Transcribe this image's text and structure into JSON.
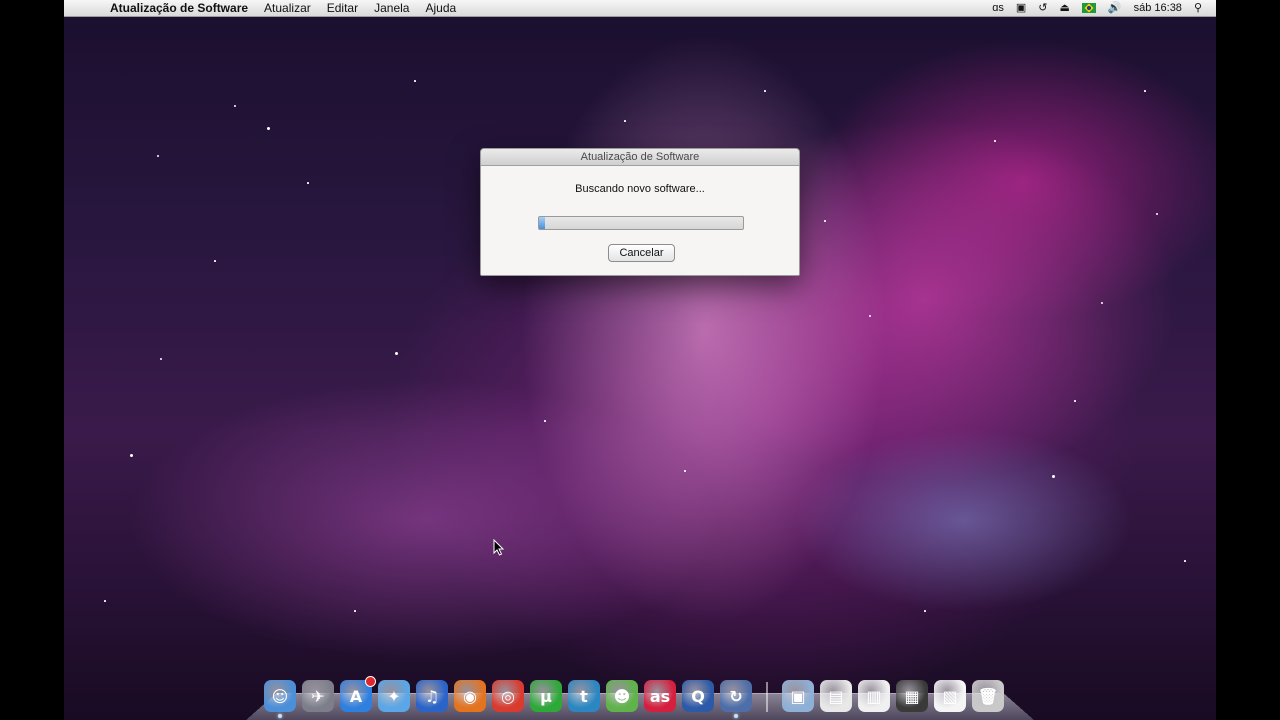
{
  "menubar": {
    "app_name": "Atualização de Software",
    "menus": [
      "Atualizar",
      "Editar",
      "Janela",
      "Ajuda"
    ],
    "clock": "sáb 16:38",
    "status_icons": [
      "lastfm-icon",
      "display-icon",
      "time-machine-icon",
      "eject-icon",
      "flag-brazil-icon",
      "volume-icon",
      "spotlight-icon"
    ]
  },
  "dialog": {
    "title": "Atualização de Software",
    "message": "Buscando novo software...",
    "progress_percent": 3,
    "cancel_label": "Cancelar"
  },
  "dock": {
    "apps": [
      {
        "name": "finder-icon",
        "glyph": "☺",
        "color": "#4a8fd8",
        "running": true
      },
      {
        "name": "launchpad-icon",
        "glyph": "✈",
        "color": "#7c7f8a",
        "running": false
      },
      {
        "name": "app-store-icon",
        "glyph": "A",
        "color": "#2f7fe0",
        "running": false,
        "badge": true
      },
      {
        "name": "safari-icon",
        "glyph": "✦",
        "color": "#5aa6e6",
        "running": false
      },
      {
        "name": "itunes-icon",
        "glyph": "♫",
        "color": "#2a64c8",
        "running": false
      },
      {
        "name": "firefox-icon",
        "glyph": "◉",
        "color": "#e4731f",
        "running": false
      },
      {
        "name": "chrome-icon",
        "glyph": "◎",
        "color": "#d93b2f",
        "running": false
      },
      {
        "name": "utorrent-icon",
        "glyph": "µ",
        "color": "#2fa83a",
        "running": false
      },
      {
        "name": "twitter-icon",
        "glyph": "t",
        "color": "#2a87c2",
        "running": false
      },
      {
        "name": "messenger-icon",
        "glyph": "☻",
        "color": "#5fb34a",
        "running": false
      },
      {
        "name": "lastfm-icon",
        "glyph": "as",
        "color": "#d51f3e",
        "running": false
      },
      {
        "name": "quicktime-icon",
        "glyph": "Q",
        "color": "#2c5aa8",
        "running": false
      },
      {
        "name": "software-update-icon",
        "glyph": "↻",
        "color": "#4d6ea8",
        "running": true
      }
    ],
    "stacks": [
      {
        "name": "applications-folder-icon",
        "glyph": "▣",
        "color": "#8fb0d6"
      },
      {
        "name": "downloads-stack-icon",
        "glyph": "▤",
        "color": "#e8e8e8"
      },
      {
        "name": "documents-stack-icon",
        "glyph": "▥",
        "color": "#f0f0f0"
      },
      {
        "name": "screenshot-stack-icon",
        "glyph": "▦",
        "color": "#3a3a3a"
      },
      {
        "name": "file-stack-icon",
        "glyph": "▧",
        "color": "#f5f5f5"
      },
      {
        "name": "trash-icon",
        "glyph": "🗑",
        "color": "#c9c9c9"
      }
    ]
  }
}
